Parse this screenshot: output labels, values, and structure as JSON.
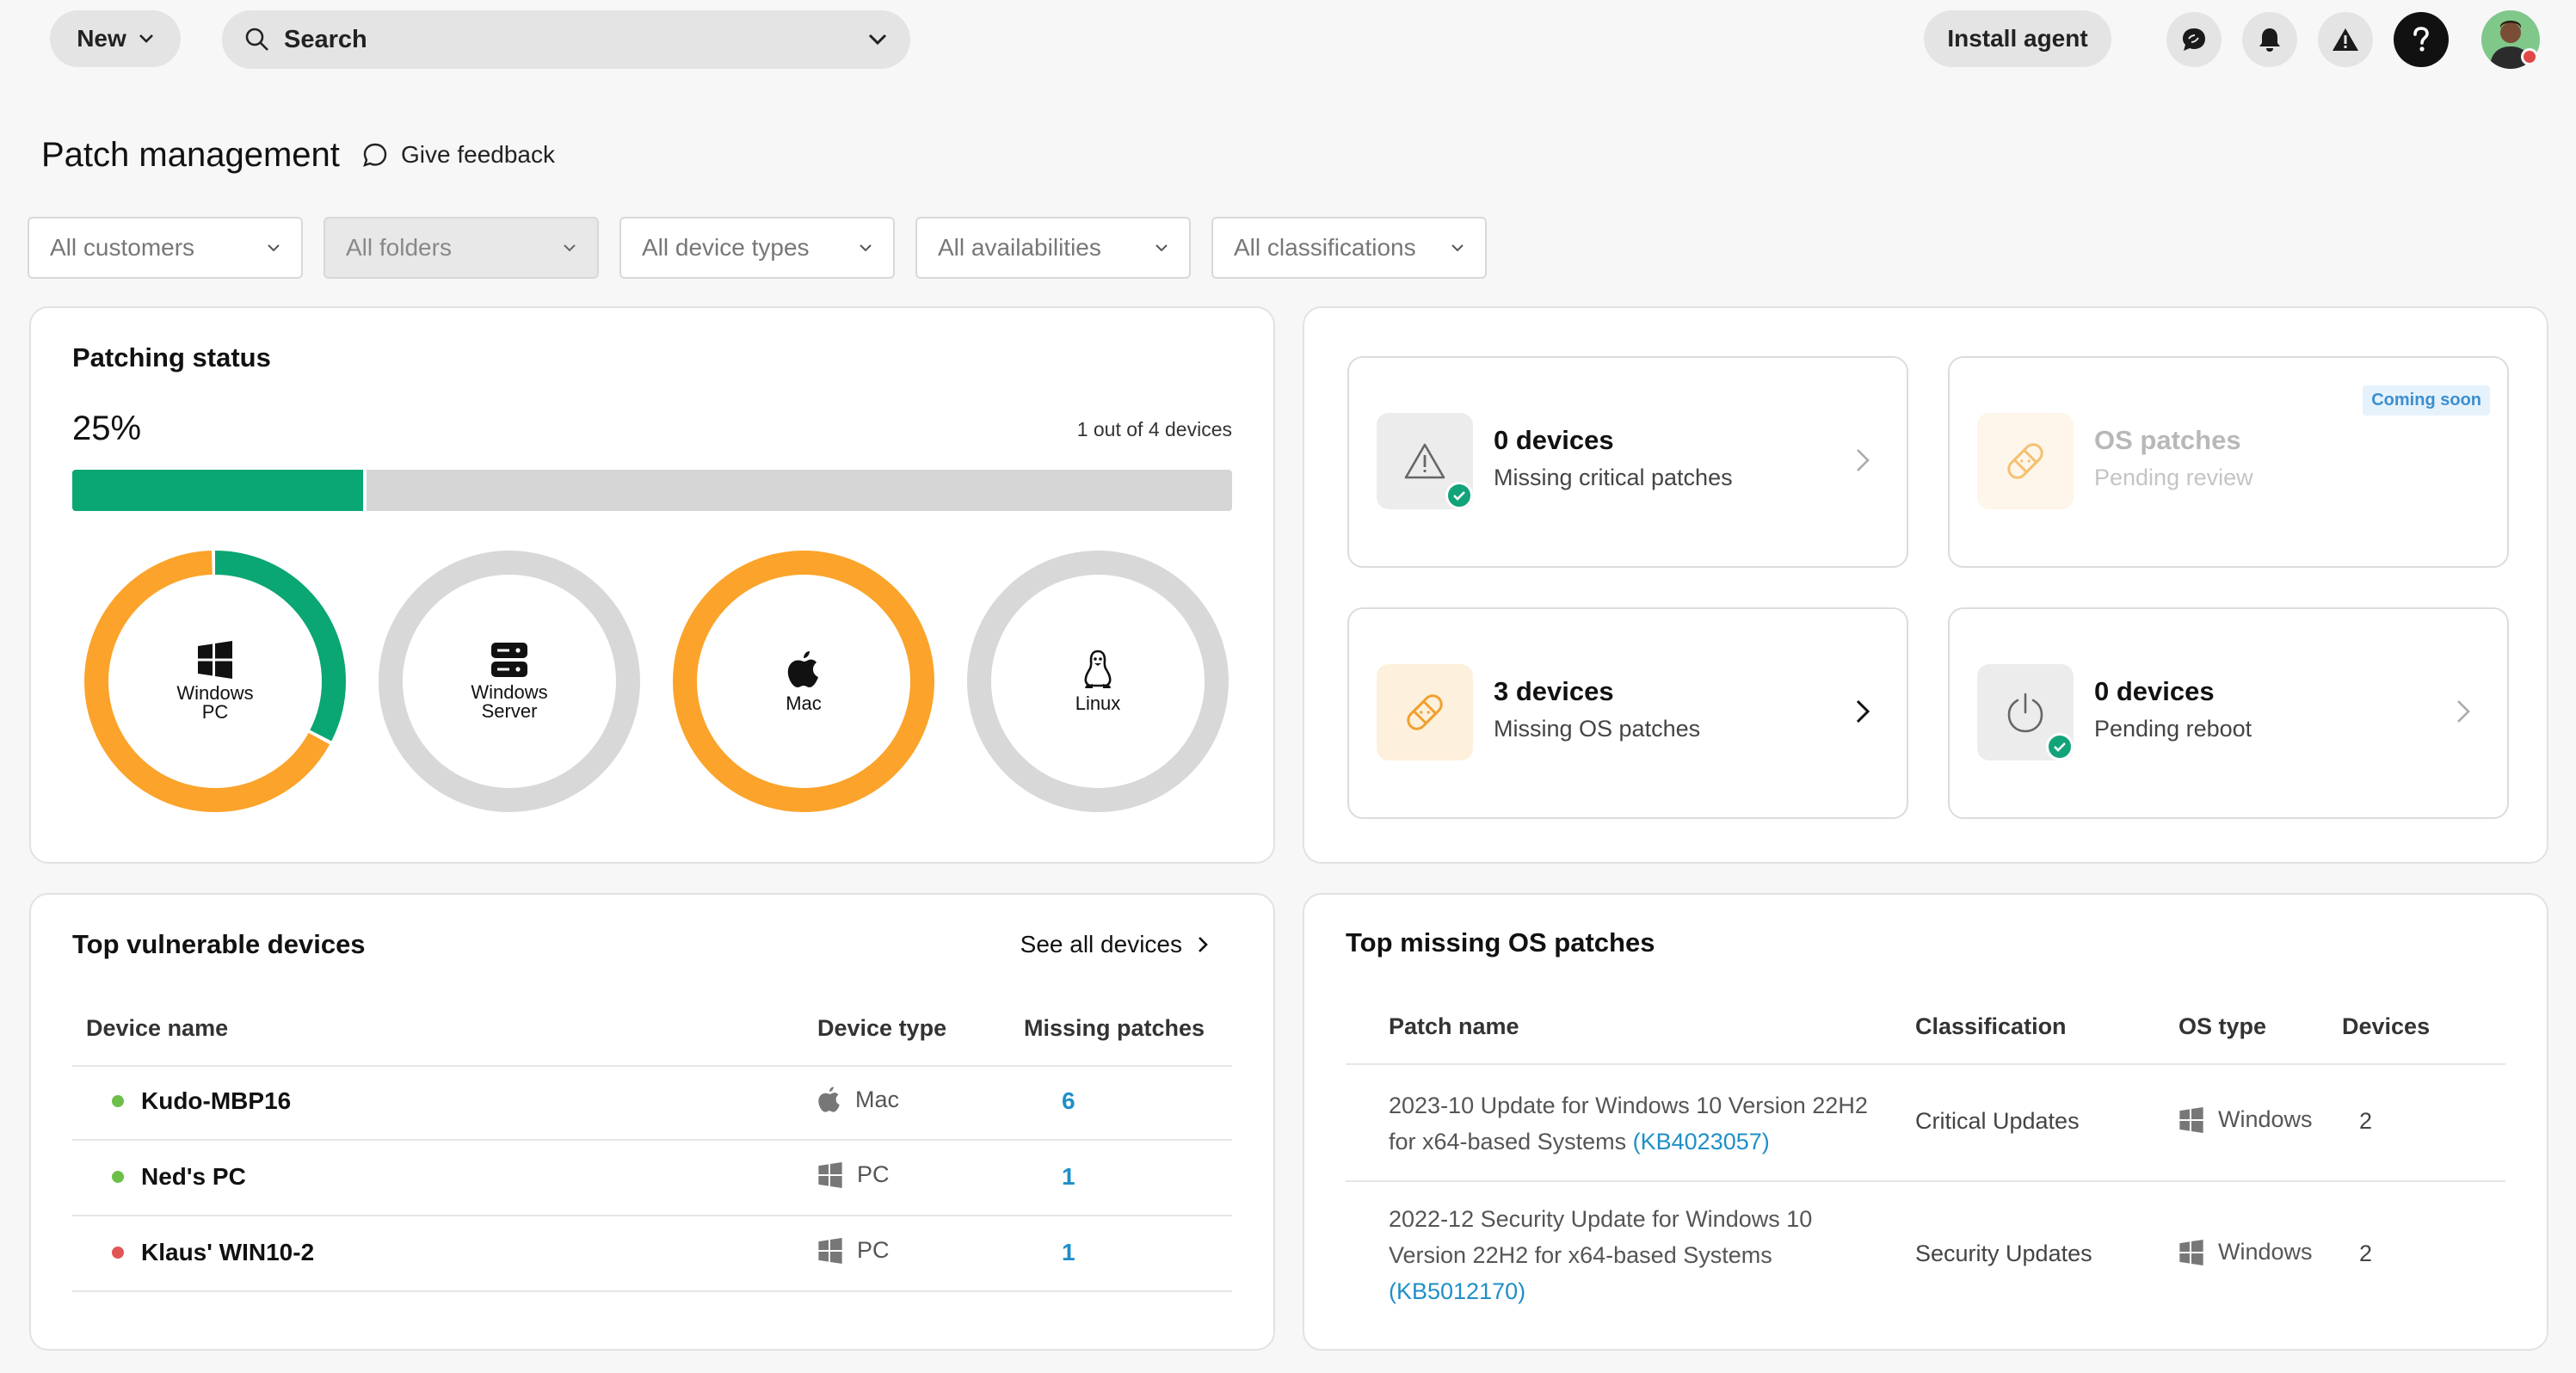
{
  "topbar": {
    "new_label": "New",
    "search_label": "Search",
    "install_label": "Install agent"
  },
  "header": {
    "title": "Patch management",
    "feedback_label": "Give feedback"
  },
  "filters": [
    {
      "label": "All customers"
    },
    {
      "label": "All folders"
    },
    {
      "label": "All device types"
    },
    {
      "label": "All availabilities"
    },
    {
      "label": "All classifications"
    }
  ],
  "patching": {
    "title": "Patching status",
    "percent_label": "25%",
    "percent": 25,
    "summary": "1 out of 4 devices",
    "donuts": [
      {
        "label": "Windows PC",
        "green": 0.33,
        "orange": 0.67,
        "grey": 0,
        "icon": "windows-icon"
      },
      {
        "label": "Windows Server",
        "green": 0,
        "orange": 0,
        "grey": 1,
        "icon": "server-icon"
      },
      {
        "label": "Mac",
        "green": 0,
        "orange": 1,
        "grey": 0,
        "icon": "apple-icon"
      },
      {
        "label": "Linux",
        "green": 0,
        "orange": 0,
        "grey": 1,
        "icon": "linux-icon"
      }
    ],
    "colors": {
      "green": "#0aa673",
      "orange": "#fba32a",
      "grey": "#d8d8d8"
    }
  },
  "cards": {
    "critical": {
      "title": "0 devices",
      "sub": "Missing critical patches"
    },
    "os_review": {
      "title": "OS patches",
      "sub": "Pending review",
      "badge": "Coming soon"
    },
    "os_missing": {
      "title": "3 devices",
      "sub": "Missing OS patches"
    },
    "reboot": {
      "title": "0 devices",
      "sub": "Pending reboot"
    }
  },
  "vulnerable": {
    "title": "Top vulnerable devices",
    "see_all": "See all devices",
    "columns": [
      "Device name",
      "Device type",
      "Missing patches"
    ],
    "rows": [
      {
        "name": "Kudo-MBP16",
        "type": "Mac",
        "missing": "6",
        "status_color": "#6cc04a",
        "icon": "apple-icon"
      },
      {
        "name": "Ned's PC",
        "type": "PC",
        "missing": "1",
        "status_color": "#6cc04a",
        "icon": "windows-icon"
      },
      {
        "name": "Klaus' WIN10-2",
        "type": "PC",
        "missing": "1",
        "status_color": "#e25555",
        "icon": "windows-icon"
      }
    ]
  },
  "missing": {
    "title": "Top missing OS patches",
    "columns": [
      "Patch name",
      "Classification",
      "OS type",
      "Devices"
    ],
    "rows": [
      {
        "name": "2023-10 Update for Windows 10 Version 22H2 for x64-based Systems",
        "kb": "(KB4023057)",
        "classification": "Critical Updates",
        "os": "Windows",
        "devices": "2"
      },
      {
        "name": "2022-12 Security Update for Windows 10 Version 22H2 for x64-based Systems",
        "kb": "(KB5012170)",
        "classification": "Security Updates",
        "os": "Windows",
        "devices": "2"
      }
    ]
  }
}
